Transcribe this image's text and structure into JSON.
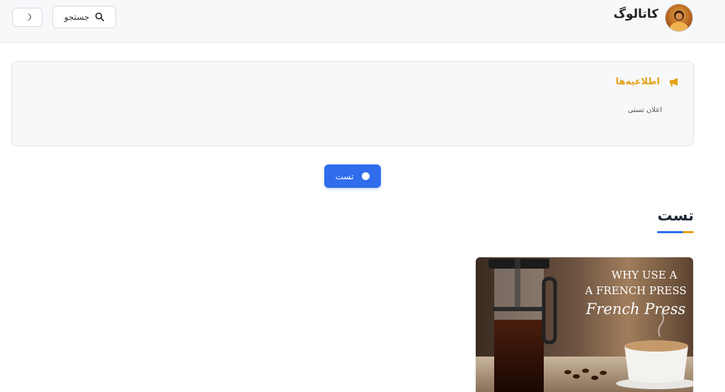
{
  "header": {
    "brand_title": "کاتالوگ",
    "search_label": "جستجو"
  },
  "announcement": {
    "title": "اطلاعیه‌ها",
    "text": "اعلان تستی"
  },
  "primary_button": {
    "label": "تست"
  },
  "section": {
    "title": "تست"
  },
  "post_card": {
    "image_text_line1": "WHY USE A",
    "image_text_line2": "A FRENCH PRESS",
    "image_text_line3": "French Press"
  },
  "colors": {
    "accent": "#2f6ded",
    "warning": "#e6a117",
    "header_bg": "#f7f8fa"
  },
  "icons": {
    "search": "search-icon",
    "theme": "moon-icon",
    "announcement": "megaphone-icon"
  }
}
